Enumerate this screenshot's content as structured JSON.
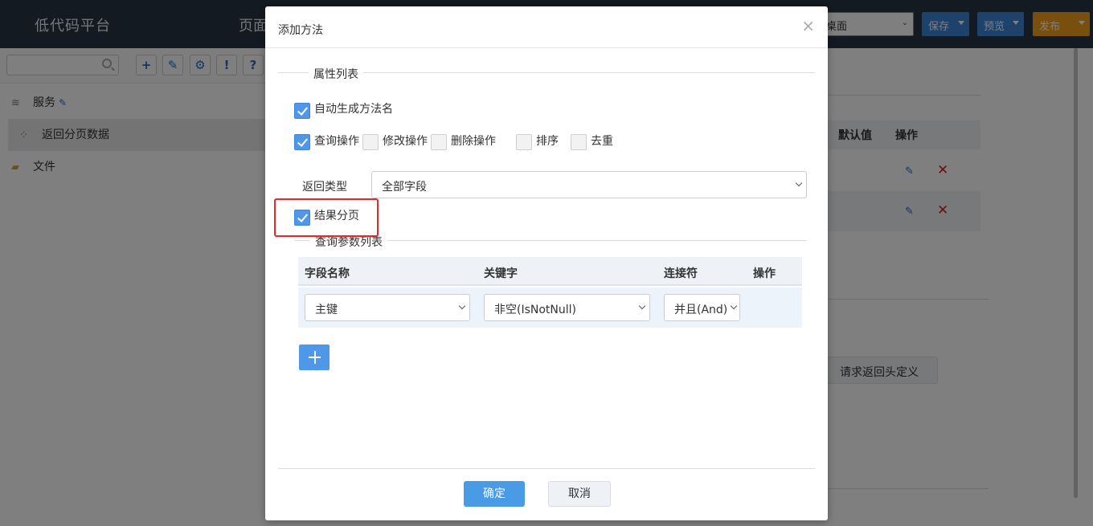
{
  "app": {
    "title": "低代码平台",
    "page_tab": "页面",
    "device_select": "桌面",
    "save_label": "保存",
    "preview_label": "预览",
    "publish_label": "发布"
  },
  "toolbar": {
    "search_placeholder": "",
    "tools": [
      "+",
      "wrench",
      "gear",
      "!",
      "?"
    ]
  },
  "tree": {
    "items": [
      {
        "icon": "layers-icon",
        "label": "服务"
      },
      {
        "icon": "service-icon",
        "label": "返回分页数据"
      },
      {
        "icon": "folder-icon",
        "label": "文件"
      }
    ]
  },
  "background_table": {
    "headers": [
      "默认值",
      "操作"
    ],
    "request_header_button": "请求返回头定义"
  },
  "modal": {
    "title": "添加方法",
    "close": "×",
    "props_legend": "属性列表",
    "auto_name_label": "自动生成方法名",
    "auto_name_checked": true,
    "operations": [
      {
        "label": "查询操作",
        "checked": true
      },
      {
        "label": "修改操作",
        "checked": false
      },
      {
        "label": "删除操作",
        "checked": false
      },
      {
        "label": "排序",
        "checked": false
      },
      {
        "label": "去重",
        "checked": false
      }
    ],
    "return_type_label": "返回类型",
    "return_type_value": "全部字段",
    "pagination_label": "结果分页",
    "pagination_checked": true,
    "query_params_legend": "查询参数列表",
    "table": {
      "headers": [
        "字段名称",
        "关键字",
        "连接符",
        "操作"
      ],
      "rows": [
        {
          "field": "主键",
          "keyword": "非空(IsNotNull)",
          "connector": "并且(And)"
        }
      ]
    },
    "confirm_label": "确定",
    "cancel_label": "取消"
  },
  "colors": {
    "topbar": "#263445",
    "primary": "#4f97e8",
    "publish": "#f09e1a",
    "highlight": "#e62828"
  }
}
